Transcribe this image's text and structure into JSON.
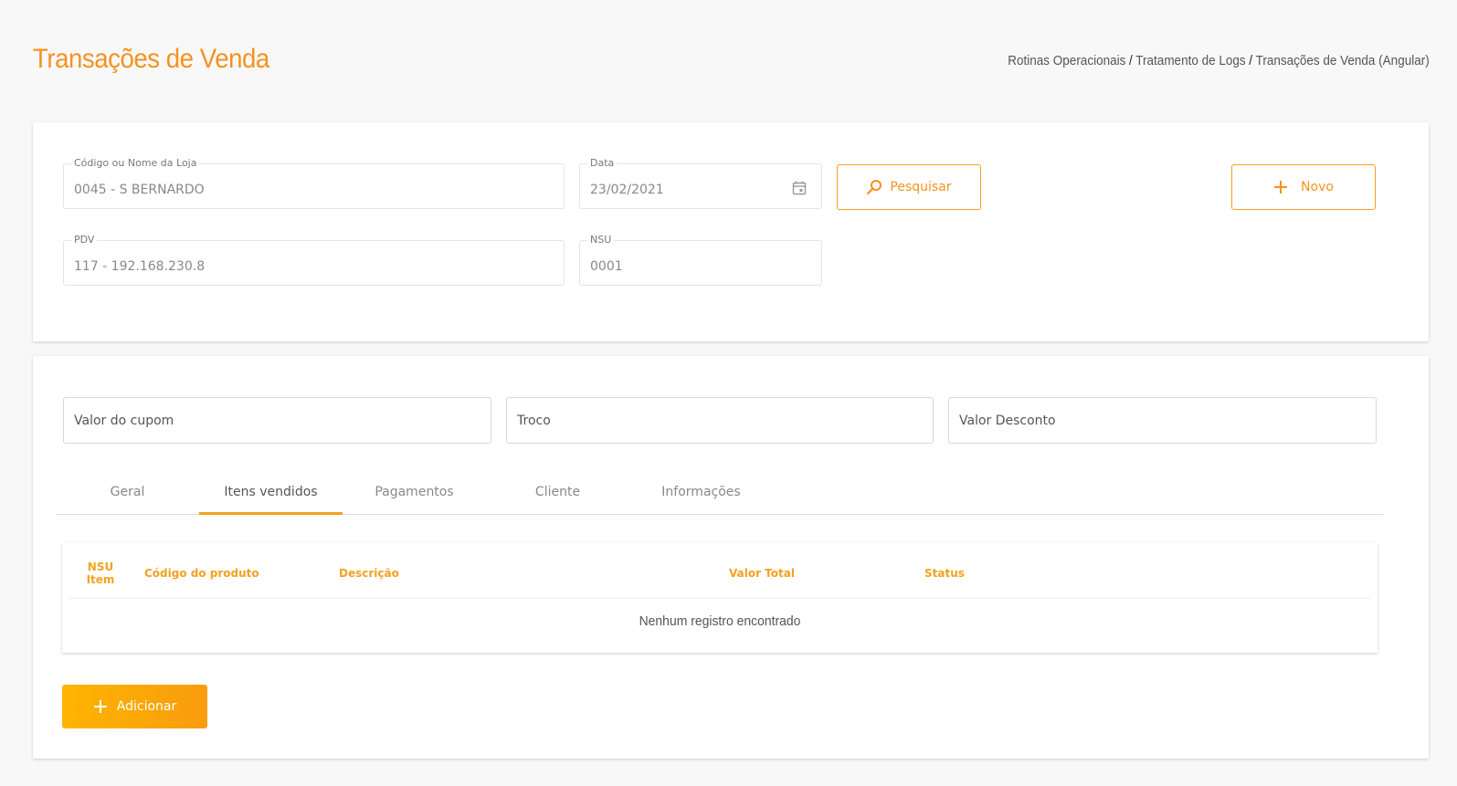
{
  "header": {
    "title": "Transações de Venda",
    "breadcrumb": [
      "Rotinas Operacionais",
      "Tratamento de Logs",
      "Transações de Venda (Angular)"
    ]
  },
  "filters": {
    "loja": {
      "label": "Código ou Nome da Loja",
      "value": "0045 - S BERNARDO"
    },
    "data": {
      "label": "Data",
      "value": "23/02/2021"
    },
    "pdv": {
      "label": "PDV",
      "value": "117 - 192.168.230.8"
    },
    "nsu": {
      "label": "NSU",
      "value": "0001"
    },
    "search_label": "Pesquisar",
    "new_label": "Novo"
  },
  "totals": {
    "valor_cupom_placeholder": "Valor do cupom",
    "troco_placeholder": "Troco",
    "valor_desconto_placeholder": "Valor Desconto"
  },
  "tabs": [
    {
      "label": "Geral",
      "active": false
    },
    {
      "label": "Itens vendidos",
      "active": true
    },
    {
      "label": "Pagamentos",
      "active": false
    },
    {
      "label": "Cliente",
      "active": false
    },
    {
      "label": "Informações",
      "active": false
    }
  ],
  "table": {
    "columns": [
      "NSU Item",
      "Código do produto",
      "Descrição",
      "Valor Total",
      "Status"
    ],
    "nsu_line1": "NSU",
    "nsu_line2": "Item",
    "empty_message": "Nenhum registro encontrado"
  },
  "add_label": "Adicionar",
  "colors": {
    "accent": "#f4921f",
    "accent_light": "#ffb400"
  }
}
